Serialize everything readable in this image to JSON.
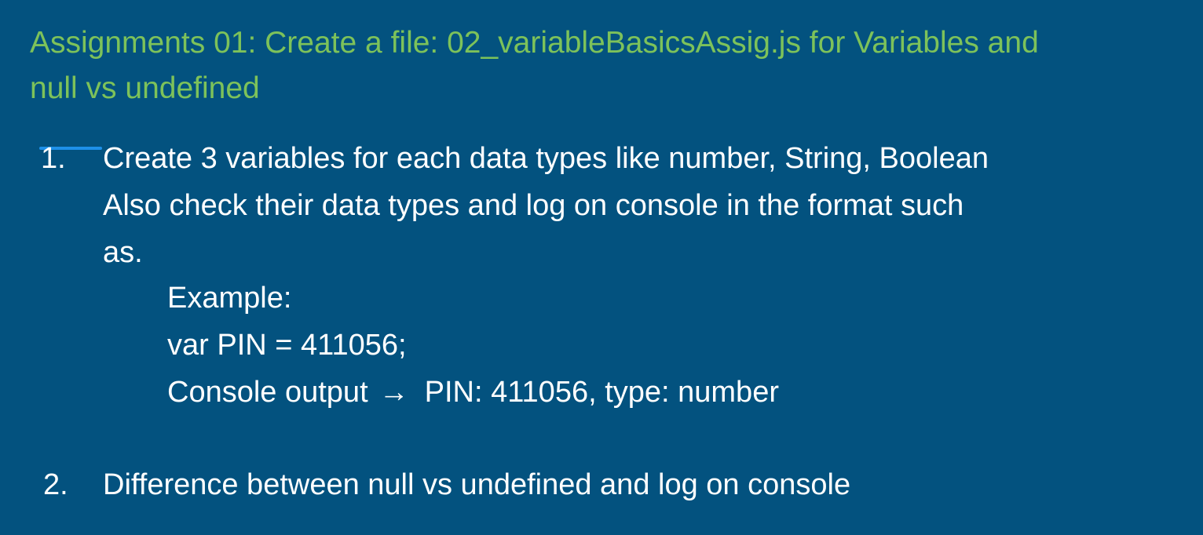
{
  "title": {
    "line1": "Assignments 01: Create a file: 02_variableBasicsAssig.js  for Variables and",
    "line2": "null vs undefined"
  },
  "items": [
    {
      "number": "1.",
      "lines": [
        "Create 3 variables for each data types like number, String, Boolean",
        "Also check their data types and log on console in the format such",
        "as."
      ],
      "example": {
        "heading": "Example:",
        "code": "var PIN = 411056;",
        "output_label": "Console output",
        "arrow": "→",
        "output_value": "PIN: 411056, type: number"
      }
    },
    {
      "number": "2.",
      "lines": [
        "Difference between null vs undefined and log on console"
      ]
    }
  ],
  "colors": {
    "background": "#03527F",
    "title": "#7DC25A",
    "text": "#FFFFFF",
    "cursor_mark": "#1E90E8"
  }
}
